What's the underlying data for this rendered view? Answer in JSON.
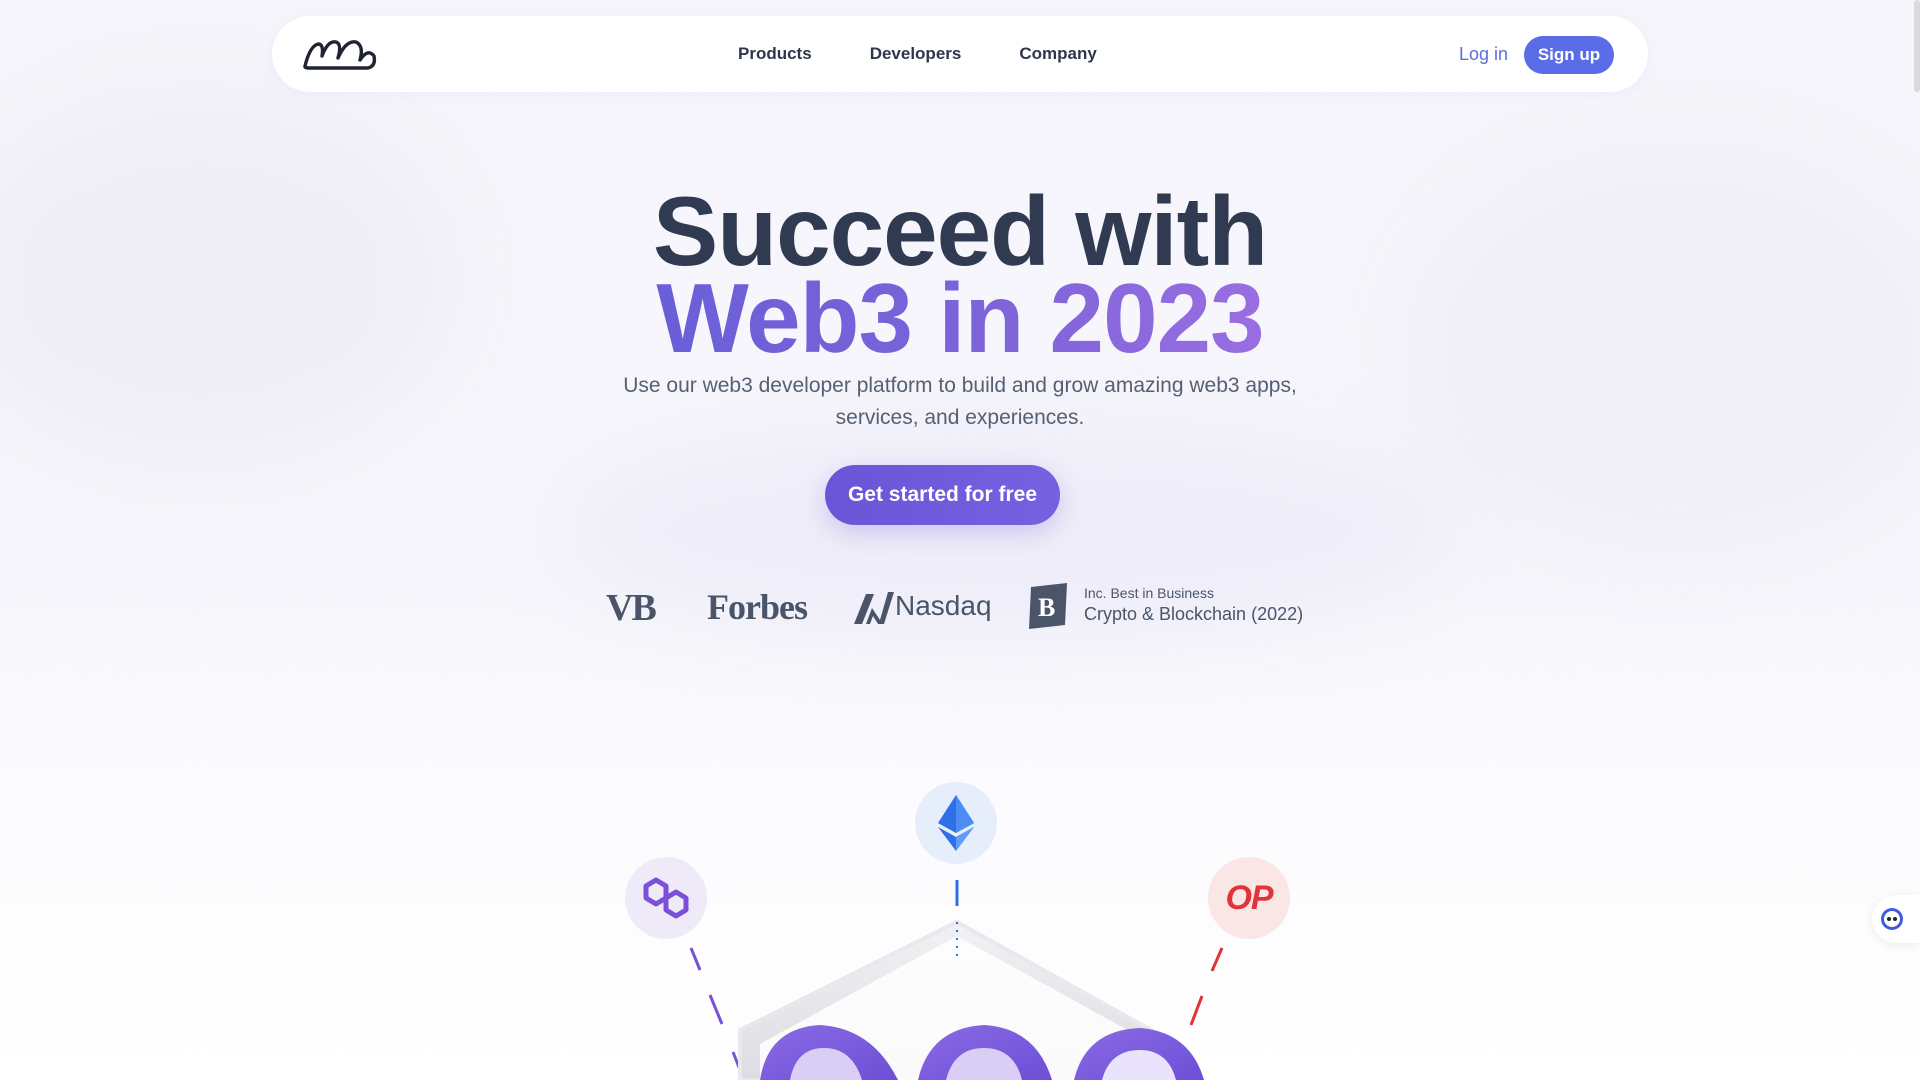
{
  "nav": {
    "links": [
      "Products",
      "Developers",
      "Company"
    ],
    "login_label": "Log in",
    "signup_label": "Sign up"
  },
  "hero": {
    "title_line1": "Succeed with",
    "title_line2": "Web3 in 2023",
    "subtitle": "Use our web3 developer platform to build and grow amazing web3 apps, services, and experiences.",
    "cta_label": "Get started for free"
  },
  "press": {
    "vb": "VB",
    "forbes": "Forbes",
    "nasdaq": "Nasdaq",
    "inc_small": "Inc. Best in Business",
    "inc_big": "Crypto & Blockchain (2022)"
  },
  "chains": {
    "op_label": "OP",
    "icons": [
      "ethereum-icon",
      "polygon-icon",
      "optimism-icon"
    ]
  },
  "colors": {
    "accent": "#5a6de6",
    "cta": "#6a55d8",
    "heading": "#303a51",
    "gradient_text": "#7d63d9",
    "ethereum": "#2f6fe8",
    "polygon": "#7b4fd8",
    "optimism": "#e0343a"
  }
}
